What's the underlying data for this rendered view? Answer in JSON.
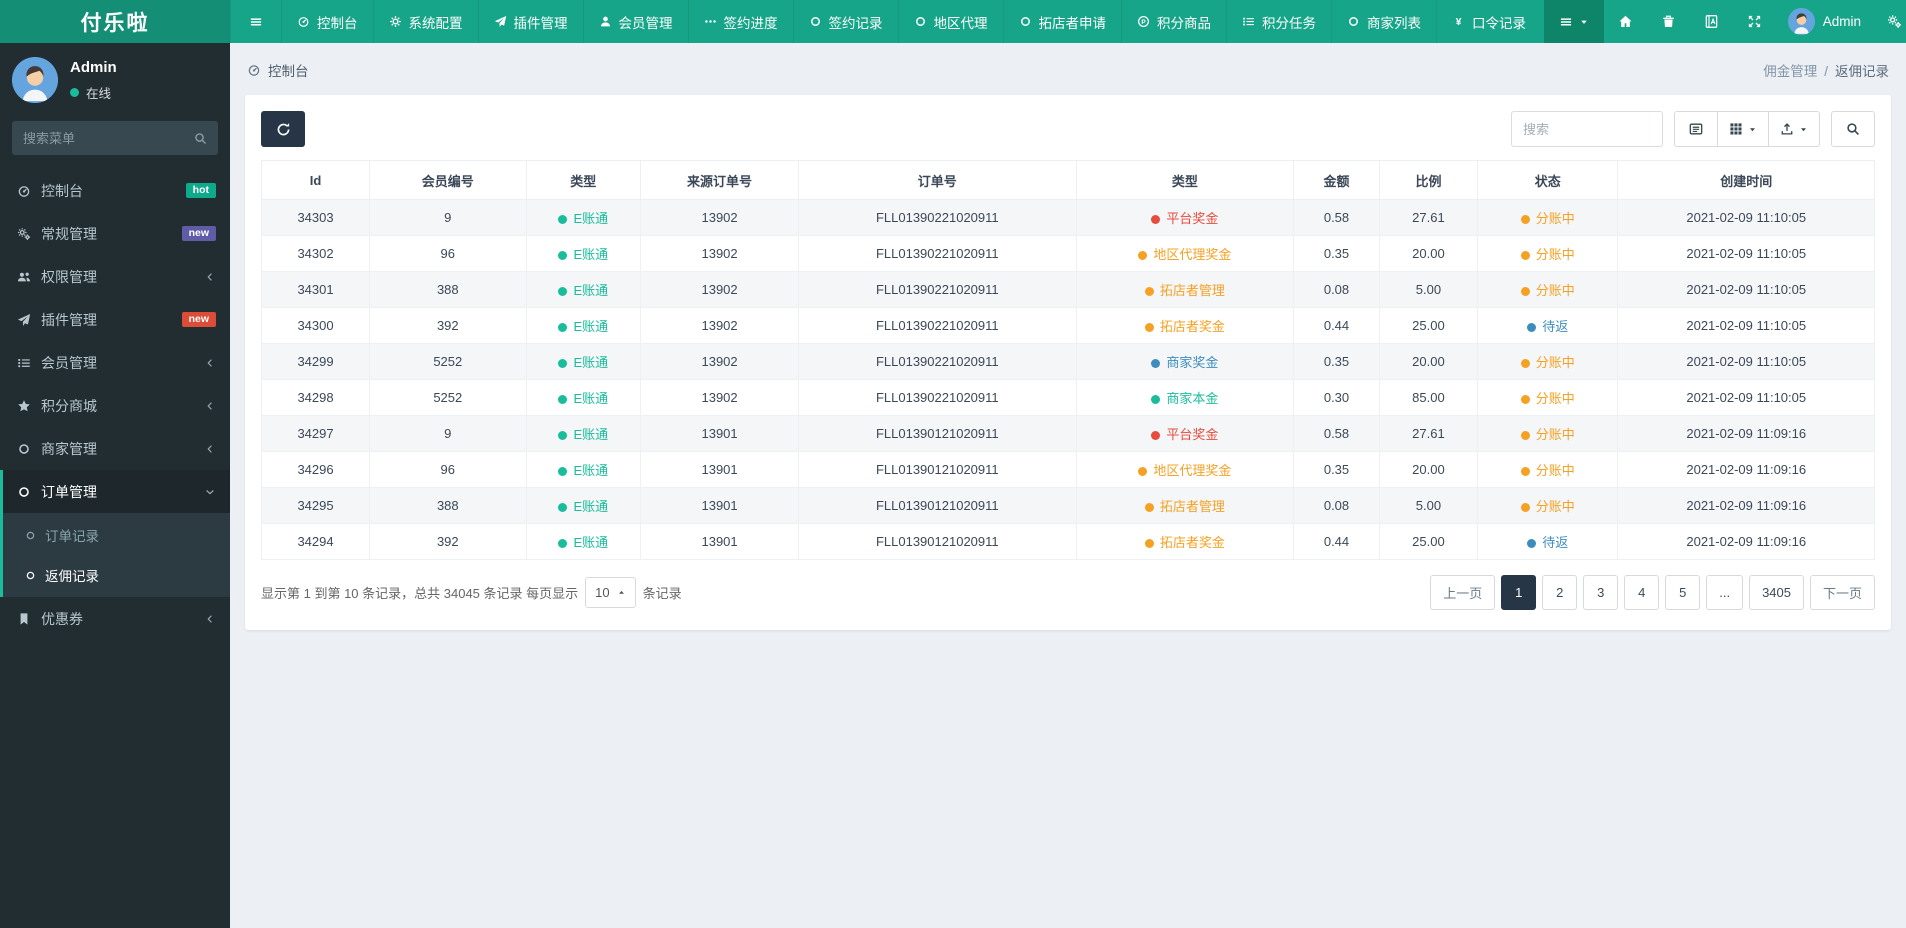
{
  "brand": "付乐啦",
  "navbar": {
    "items": [
      {
        "label": "控制台",
        "icon": "dashboard"
      },
      {
        "label": "系统配置",
        "icon": "gear"
      },
      {
        "label": "插件管理",
        "icon": "paper-plane"
      },
      {
        "label": "会员管理",
        "icon": "user"
      },
      {
        "label": "签约进度",
        "icon": "ellipsis"
      },
      {
        "label": "签约记录",
        "icon": "circle"
      },
      {
        "label": "地区代理",
        "icon": "circle"
      },
      {
        "label": "拓店者申请",
        "icon": "circle"
      },
      {
        "label": "积分商品",
        "icon": "product-hunt"
      },
      {
        "label": "积分任务",
        "icon": "list"
      },
      {
        "label": "商家列表",
        "icon": "circle"
      },
      {
        "label": "口令记录",
        "icon": "yen"
      }
    ],
    "user_name": "Admin"
  },
  "sidebar": {
    "user_name": "Admin",
    "user_status": "在线",
    "search_placeholder": "搜索菜单",
    "items": [
      {
        "label": "控制台",
        "icon": "dashboard",
        "badge": {
          "text": "hot",
          "color": "#0fa98c"
        }
      },
      {
        "label": "常规管理",
        "icon": "gears",
        "badge": {
          "text": "new",
          "color": "#605ca8"
        }
      },
      {
        "label": "权限管理",
        "icon": "users",
        "arrow": "left"
      },
      {
        "label": "插件管理",
        "icon": "paper-plane",
        "badge": {
          "text": "new",
          "color": "#dd4b39"
        }
      },
      {
        "label": "会员管理",
        "icon": "list",
        "arrow": "left"
      },
      {
        "label": "积分商城",
        "icon": "star",
        "arrow": "left"
      },
      {
        "label": "商家管理",
        "icon": "circle",
        "arrow": "left"
      },
      {
        "label": "订单管理",
        "icon": "circle",
        "arrow": "down",
        "active": true,
        "children": [
          {
            "label": "订单记录",
            "active": false
          },
          {
            "label": "返佣记录",
            "active": true
          }
        ]
      },
      {
        "label": "优惠券",
        "icon": "bookmark",
        "arrow": "left"
      }
    ]
  },
  "content": {
    "breadcrumb": "控制台",
    "breadcrumb_right": {
      "parent": "佣金管理",
      "separator": "/",
      "current": "返佣记录"
    },
    "toolbar": {
      "search_placeholder": "搜索"
    },
    "table": {
      "columns": [
        "Id",
        "会员编号",
        "类型",
        "来源订单号",
        "订单号",
        "类型",
        "金额",
        "比例",
        "状态",
        "创建时间"
      ],
      "rows": [
        {
          "id": "34303",
          "member": "9",
          "wallet": {
            "text": "E账通",
            "color": "#1abc9c"
          },
          "source": "13902",
          "order": "FLL01390221020911",
          "type": {
            "text": "平台奖金",
            "color": "#e74c3c"
          },
          "amount": "0.58",
          "ratio": "27.61",
          "status": {
            "text": "分账中",
            "color": "#f5a123"
          },
          "created": "2021-02-09 11:10:05"
        },
        {
          "id": "34302",
          "member": "96",
          "wallet": {
            "text": "E账通",
            "color": "#1abc9c"
          },
          "source": "13902",
          "order": "FLL01390221020911",
          "type": {
            "text": "地区代理奖金",
            "color": "#f5a123"
          },
          "amount": "0.35",
          "ratio": "20.00",
          "status": {
            "text": "分账中",
            "color": "#f5a123"
          },
          "created": "2021-02-09 11:10:05"
        },
        {
          "id": "34301",
          "member": "388",
          "wallet": {
            "text": "E账通",
            "color": "#1abc9c"
          },
          "source": "13902",
          "order": "FLL01390221020911",
          "type": {
            "text": "拓店者管理",
            "color": "#f5a123"
          },
          "amount": "0.08",
          "ratio": "5.00",
          "status": {
            "text": "分账中",
            "color": "#f5a123"
          },
          "created": "2021-02-09 11:10:05"
        },
        {
          "id": "34300",
          "member": "392",
          "wallet": {
            "text": "E账通",
            "color": "#1abc9c"
          },
          "source": "13902",
          "order": "FLL01390221020911",
          "type": {
            "text": "拓店者奖金",
            "color": "#f5a123"
          },
          "amount": "0.44",
          "ratio": "25.00",
          "status": {
            "text": "待返",
            "color": "#3c8dbc"
          },
          "created": "2021-02-09 11:10:05"
        },
        {
          "id": "34299",
          "member": "5252",
          "wallet": {
            "text": "E账通",
            "color": "#1abc9c"
          },
          "source": "13902",
          "order": "FLL01390221020911",
          "type": {
            "text": "商家奖金",
            "color": "#3c8dbc"
          },
          "amount": "0.35",
          "ratio": "20.00",
          "status": {
            "text": "分账中",
            "color": "#f5a123"
          },
          "created": "2021-02-09 11:10:05"
        },
        {
          "id": "34298",
          "member": "5252",
          "wallet": {
            "text": "E账通",
            "color": "#1abc9c"
          },
          "source": "13902",
          "order": "FLL01390221020911",
          "type": {
            "text": "商家本金",
            "color": "#1abc9c"
          },
          "amount": "0.30",
          "ratio": "85.00",
          "status": {
            "text": "分账中",
            "color": "#f5a123"
          },
          "created": "2021-02-09 11:10:05"
        },
        {
          "id": "34297",
          "member": "9",
          "wallet": {
            "text": "E账通",
            "color": "#1abc9c"
          },
          "source": "13901",
          "order": "FLL01390121020911",
          "type": {
            "text": "平台奖金",
            "color": "#e74c3c"
          },
          "amount": "0.58",
          "ratio": "27.61",
          "status": {
            "text": "分账中",
            "color": "#f5a123"
          },
          "created": "2021-02-09 11:09:16"
        },
        {
          "id": "34296",
          "member": "96",
          "wallet": {
            "text": "E账通",
            "color": "#1abc9c"
          },
          "source": "13901",
          "order": "FLL01390121020911",
          "type": {
            "text": "地区代理奖金",
            "color": "#f5a123"
          },
          "amount": "0.35",
          "ratio": "20.00",
          "status": {
            "text": "分账中",
            "color": "#f5a123"
          },
          "created": "2021-02-09 11:09:16"
        },
        {
          "id": "34295",
          "member": "388",
          "wallet": {
            "text": "E账通",
            "color": "#1abc9c"
          },
          "source": "13901",
          "order": "FLL01390121020911",
          "type": {
            "text": "拓店者管理",
            "color": "#f5a123"
          },
          "amount": "0.08",
          "ratio": "5.00",
          "status": {
            "text": "分账中",
            "color": "#f5a123"
          },
          "created": "2021-02-09 11:09:16"
        },
        {
          "id": "34294",
          "member": "392",
          "wallet": {
            "text": "E账通",
            "color": "#1abc9c"
          },
          "source": "13901",
          "order": "FLL01390121020911",
          "type": {
            "text": "拓店者奖金",
            "color": "#f5a123"
          },
          "amount": "0.44",
          "ratio": "25.00",
          "status": {
            "text": "待返",
            "color": "#3c8dbc"
          },
          "created": "2021-02-09 11:09:16"
        }
      ]
    },
    "footer": {
      "summary_prefix": "显示第 1 到第 10 条记录，总共 34045 条记录 每页显示",
      "per_page": "10",
      "summary_suffix": "条记录",
      "pages": [
        {
          "label": "上一页",
          "type": "prev"
        },
        {
          "label": "1",
          "active": true
        },
        {
          "label": "2"
        },
        {
          "label": "3"
        },
        {
          "label": "4"
        },
        {
          "label": "5"
        },
        {
          "label": "..."
        },
        {
          "label": "3405"
        },
        {
          "label": "下一页",
          "type": "next"
        }
      ]
    }
  },
  "colors": {
    "navbar": "#17a589",
    "accent": "#1abc9c",
    "sidebar": "#222d32",
    "dark_button": "#263646",
    "type_red": "#e74c3c",
    "type_orange": "#f5a123",
    "type_blue": "#3c8dbc",
    "type_green": "#1abc9c"
  }
}
